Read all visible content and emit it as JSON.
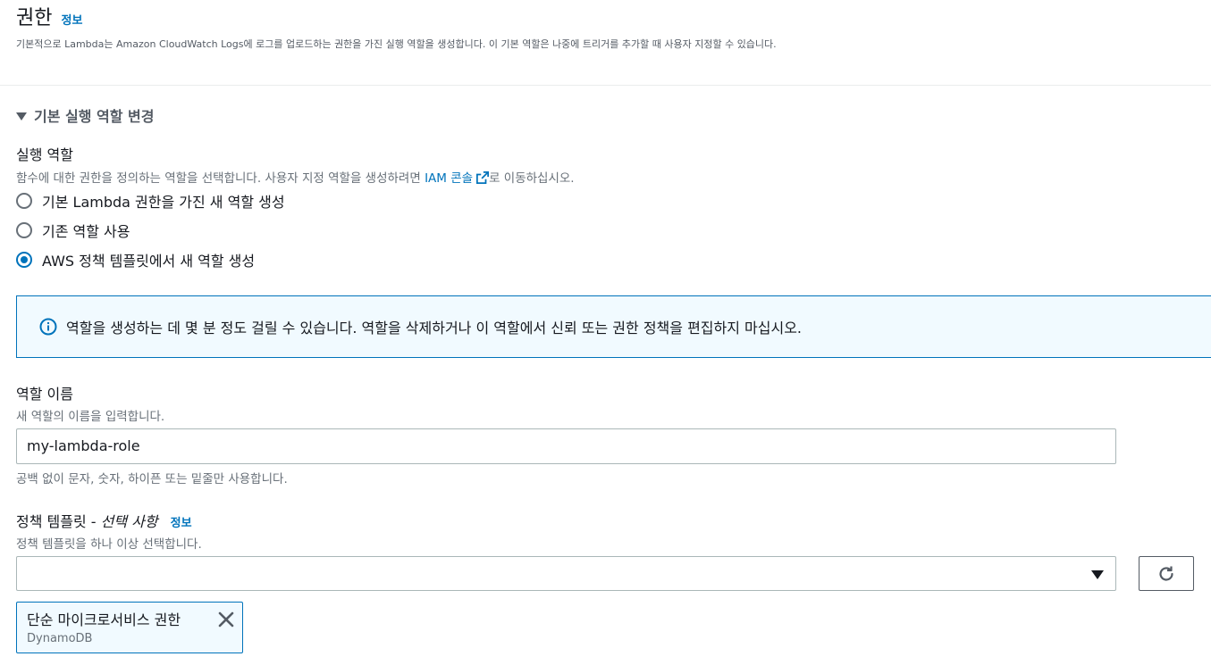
{
  "permissions": {
    "title": "권한",
    "info_link": "정보",
    "description": "기본적으로 Lambda는 Amazon CloudWatch Logs에 로그를 업로드하는 권한을 가진 실행 역할을 생성합니다. 이 기본 역할은 나중에 트리거를 추가할 때 사용자 지정할 수 있습니다."
  },
  "expander": {
    "label": "기본 실행 역할 변경",
    "expanded": true
  },
  "execution_role": {
    "label": "실행 역할",
    "description_prefix": "함수에 대한 권한을 정의하는 역할을 선택합니다. 사용자 지정 역할을 생성하려면 ",
    "link_text": "IAM 콘솔",
    "description_suffix": "로 이동하십시오.",
    "options": [
      {
        "label": "기본 Lambda 권한을 가진 새 역할 생성",
        "selected": false
      },
      {
        "label": "기존 역할 사용",
        "selected": false
      },
      {
        "label": "AWS 정책 템플릿에서 새 역할 생성",
        "selected": true
      }
    ]
  },
  "alert": {
    "icon": "info-icon",
    "text": "역할을 생성하는 데 몇 분 정도 걸릴 수 있습니다. 역할을 삭제하거나 이 역할에서 신뢰 또는 권한 정책을 편집하지 마십시오."
  },
  "role_name": {
    "label": "역할 이름",
    "description": "새 역할의 이름을 입력합니다.",
    "value": "my-lambda-role",
    "constraint": "공백 없이 문자, 숫자, 하이픈 또는 밑줄만 사용합니다."
  },
  "policy_templates": {
    "label": "정책 템플릿 - ",
    "label_optional": "선택 사항",
    "info_link": "정보",
    "description": "정책 템플릿을 하나 이상 선택합니다.",
    "selected_value": "",
    "tokens": [
      {
        "title": "단순 마이크로서비스 권한",
        "subtitle": "DynamoDB"
      }
    ]
  },
  "colors": {
    "accent": "#0073bb",
    "alert_bg": "#f1faff",
    "text": "#16191f",
    "muted": "#687078"
  }
}
